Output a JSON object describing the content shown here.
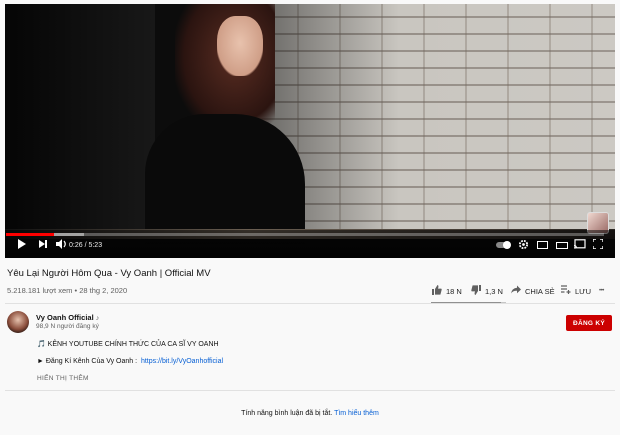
{
  "player": {
    "time_current": "0:26",
    "time_separator": " / ",
    "time_total": "5:23",
    "progress_fraction": 0.08,
    "buffer_fraction": 0.13,
    "icons": [
      "play-icon",
      "next-icon",
      "volume-icon",
      "autoplay-toggle",
      "settings-icon",
      "miniplayer-icon",
      "theater-icon",
      "cast-icon",
      "fullscreen-icon"
    ]
  },
  "video": {
    "title": "Yêu Lại Người Hôm Qua - Vy Oanh | Official MV",
    "views": "5.218.181 lượt xem",
    "dot": " • ",
    "date": "28 thg 2, 2020"
  },
  "actions": {
    "likes": "18 N",
    "dislikes": "1,3 N",
    "share": "CHIA SẺ",
    "save": "LƯU",
    "more": "•••",
    "like_ratio": 0.93
  },
  "channel": {
    "name": "Vy Oanh Official",
    "verified": "♪",
    "subscribers": "98,9 N người đăng ký",
    "subscribe": "ĐĂNG KÝ"
  },
  "description": {
    "line1": "🎵 KÊNH YOUTUBE CHÍNH THỨC CỦA CA SĨ VY OANH",
    "line2_prefix": "► Đăng Kí Kênh Của Vy Oanh :  ",
    "line2_link": "https://bit.ly/VyOanhofficial",
    "show_more": "HIỂN THỊ THÊM"
  },
  "comments": {
    "disabled_text": "Tính năng bình luận đã bị tắt. ",
    "learn_more": "Tìm hiểu thêm"
  },
  "colors": {
    "accent_red": "#ff0000",
    "subscribe_red": "#cc0000",
    "link_blue": "#065fd4"
  }
}
